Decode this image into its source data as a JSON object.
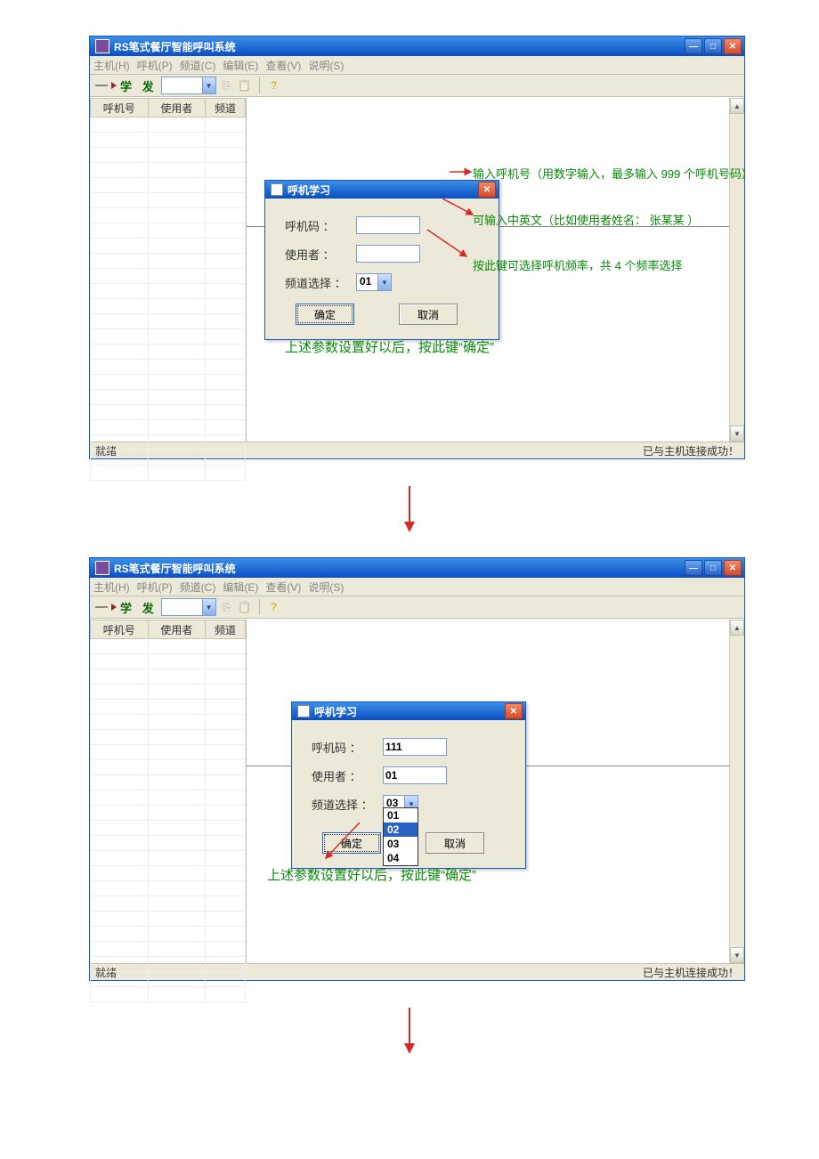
{
  "app": {
    "title": "RS笔式餐厅智能呼叫系统",
    "menus": [
      "主机(H)",
      "呼机(P)",
      "频道(C)",
      "编辑(E)",
      "查看(V)",
      "说明(S)"
    ],
    "toolbar_text": "学 发",
    "status_left": "就绪",
    "status_right": "已与主机连接成功！",
    "columns": [
      "呼机号",
      "使用者",
      "频道"
    ]
  },
  "dialog": {
    "title": "呼机学习",
    "label_code": "呼机码 ：",
    "label_user": "使用者 ：",
    "label_channel": "频道选择 ：",
    "btn_ok": "确定",
    "btn_cancel": "取消"
  },
  "shot1": {
    "code": "",
    "user": "",
    "channel": "01",
    "annot1": "输入呼机号（用数字输入，最多输入 999 个呼机号码）",
    "annot2": "可输入中英文（比如使用者姓名：  张某某 ）",
    "annot3": "按此键可选择呼机频率，共 4 个频率选择",
    "annot_confirm": "上述参数设置好以后，按此键“确定”"
  },
  "shot2": {
    "code": "111",
    "user": "01",
    "channel": "03",
    "dropdown": [
      "01",
      "02",
      "03",
      "04"
    ],
    "selected": "02",
    "annot_confirm": "上述参数设置好以后，按此键“确定”"
  }
}
